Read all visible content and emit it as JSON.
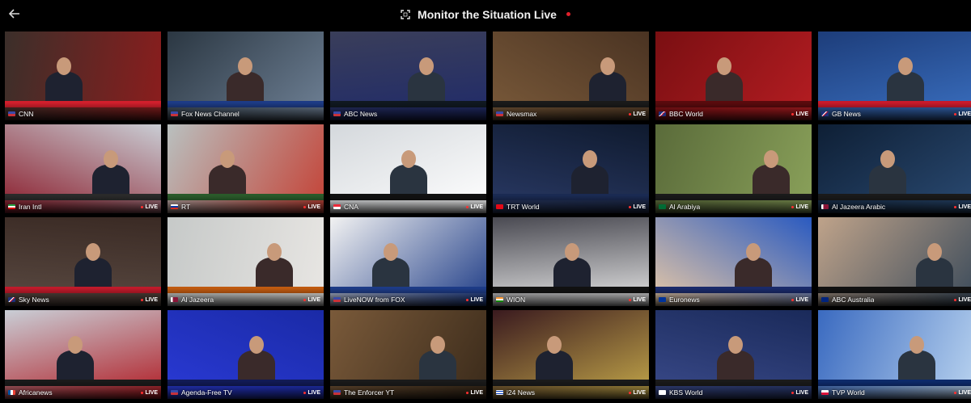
{
  "header": {
    "title": "Monitor the Situation Live"
  },
  "live_label": "LIVE",
  "colors": {
    "accent": "#e0202a",
    "background": "#000000"
  },
  "icons": {
    "back": "arrow-left-icon",
    "fullscreen": "fullscreen-icon"
  },
  "channels": [
    {
      "name": "CNN",
      "flag": "us",
      "bg": "#3b2f2a",
      "bg2": "#8b1d1d",
      "banner": "#d21f2c",
      "live": false
    },
    {
      "name": "Fox News Channel",
      "flag": "us",
      "bg": "#2b3742",
      "bg2": "#6f8196",
      "banner": "#1d3b86",
      "live": false
    },
    {
      "name": "ABC News",
      "flag": "us",
      "bg": "#3a3e5a",
      "bg2": "#1f2a6a",
      "banner": "#101820",
      "live": false
    },
    {
      "name": "Newsmax",
      "flag": "us",
      "bg": "#4a3322",
      "bg2": "#7a5a3a",
      "banner": "#1a1a1a",
      "live": true
    },
    {
      "name": "BBC World",
      "flag": "gb",
      "bg": "#7a0f12",
      "bg2": "#b51d22",
      "banner": "#5a0a0d",
      "live": true
    },
    {
      "name": "GB News",
      "flag": "gb",
      "bg": "#1d3d7a",
      "bg2": "#3a6fc0",
      "banner": "#c91a2b",
      "live": true
    },
    {
      "name": "Iran Intl",
      "flag": "ir",
      "bg": "#c9cdd4",
      "bg2": "#8a1b2a",
      "banner": "#2a2a2a",
      "live": true
    },
    {
      "name": "RT",
      "flag": "ru",
      "bg": "#b9c0bf",
      "bg2": "#c44236",
      "banner": "#2a5a2a",
      "live": true
    },
    {
      "name": "CNA",
      "flag": "sg",
      "bg": "#d4d8dc",
      "bg2": "#ffffff",
      "banner": "#111111",
      "live": true
    },
    {
      "name": "TRT World",
      "flag": "tr",
      "bg": "#0f1a2e",
      "bg2": "#2a3a66",
      "banner": "#1a2a52",
      "live": true
    },
    {
      "name": "Al Arabiya",
      "flag": "sa",
      "bg": "#5a6b3a",
      "bg2": "#8aa15a",
      "banner": "#1a1a1a",
      "live": true
    },
    {
      "name": "Al Jazeera Arabic",
      "flag": "qa",
      "bg": "#0e1f35",
      "bg2": "#2a4a72",
      "banner": "#1a1a1a",
      "live": true
    },
    {
      "name": "Sky News",
      "flag": "gb",
      "bg": "#3a2a24",
      "bg2": "#5a4a42",
      "banner": "#c01a2a",
      "live": true
    },
    {
      "name": "Al Jazeera",
      "flag": "qa",
      "bg": "#c6c9c8",
      "bg2": "#e8e6e3",
      "banner": "#c05a10",
      "live": true
    },
    {
      "name": "LiveNOW from FOX",
      "flag": "us",
      "bg": "#f2f2f2",
      "bg2": "#1d3b86",
      "banner": "#1d3b86",
      "live": true
    },
    {
      "name": "WION",
      "flag": "in",
      "bg": "#4a4a52",
      "bg2": "#e6e6e6",
      "banner": "#111111",
      "live": true
    },
    {
      "name": "Euronews",
      "flag": "eu",
      "bg": "#2a5ac0",
      "bg2": "#e8c9a6",
      "banner": "#1a2a6a",
      "live": true
    },
    {
      "name": "ABC Australia",
      "flag": "au",
      "bg": "#bfa38a",
      "bg2": "#3a4a5a",
      "banner": "#111111",
      "live": true
    },
    {
      "name": "Africanews",
      "flag": "fr",
      "bg": "#c9ced6",
      "bg2": "#b01a22",
      "banner": "#1a1a1a",
      "live": true
    },
    {
      "name": "Agenda-Free TV",
      "flag": "us",
      "bg": "#1a2aa6",
      "bg2": "#2a3ad6",
      "banner": "#111a55",
      "live": true
    },
    {
      "name": "The Enforcer YT",
      "flag": "us",
      "bg": "#7a5a3a",
      "bg2": "#3a2a1a",
      "banner": "#1a1a1a",
      "live": true
    },
    {
      "name": "i24 News",
      "flag": "il",
      "bg": "#3a1a1f",
      "bg2": "#c4a84a",
      "banner": "#1a1a1a",
      "live": true
    },
    {
      "name": "KBS World",
      "flag": "kr",
      "bg": "#1a2a5a",
      "bg2": "#3a4a8a",
      "banner": "#1a1a1a",
      "live": true
    },
    {
      "name": "TVP World",
      "flag": "pl",
      "bg": "#3a6ac0",
      "bg2": "#b9d3ef",
      "banner": "#0d2a6a",
      "live": true
    }
  ]
}
